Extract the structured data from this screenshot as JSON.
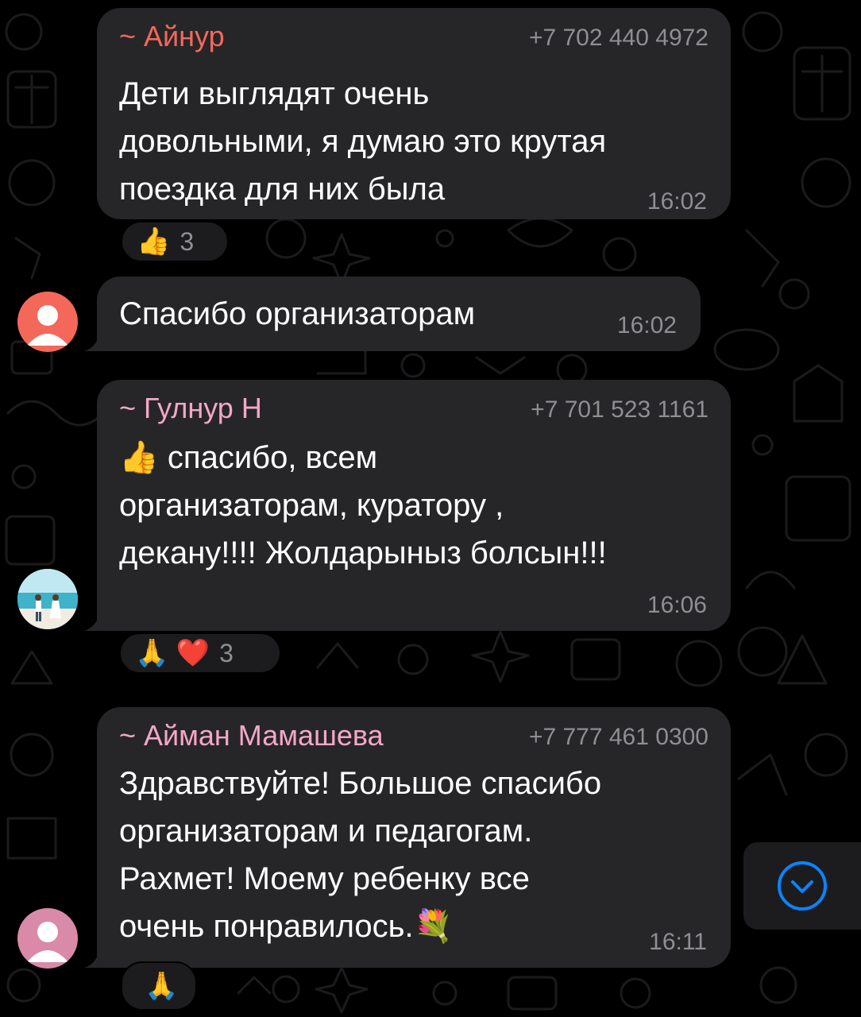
{
  "colors": {
    "bubble": "#262628",
    "background": "#000000",
    "sender_ainur": "#f4685a",
    "sender_gulnur": "#f5a7c7",
    "sender_aiman": "#f5a7c7",
    "meta": "#8e8e93",
    "scroll_accent": "#0a84ff"
  },
  "messages": [
    {
      "sender": "~ Айнур",
      "phone": "+7 702 440 4972",
      "text": "Дети выглядят очень\nдовольными, я думаю это крутая\nпоездка для них была",
      "time": "16:02",
      "reaction": {
        "emojis": "👍",
        "count": "3"
      }
    },
    {
      "text": "Спасибо организаторам",
      "time": "16:02",
      "avatar": "person-icon"
    },
    {
      "sender": "~ Гулнур Н",
      "phone": "+7 701 523 1161",
      "text": "👍 спасибо, всем\nорганизаторам, куратору ,\nдекану!!!! Жолдарыныз болсын!!!",
      "time": "16:06",
      "avatar": "photo-avatar",
      "reaction": {
        "emojis": "🙏 ❤️",
        "count": "3"
      }
    },
    {
      "sender": "~ Айман Мамашева",
      "phone": "+7 777 461 0300",
      "text": "Здравствуйте! Большое спасибо\nорганизаторам и педагогам.\nРахмет! Моему ребенку все\nочень понравилось.💐",
      "time": "16:11",
      "avatar": "person-icon",
      "reaction": {
        "emojis": "🙏",
        "count": ""
      }
    }
  ],
  "scroll_button": {
    "icon": "chevron-down-circle-icon"
  }
}
